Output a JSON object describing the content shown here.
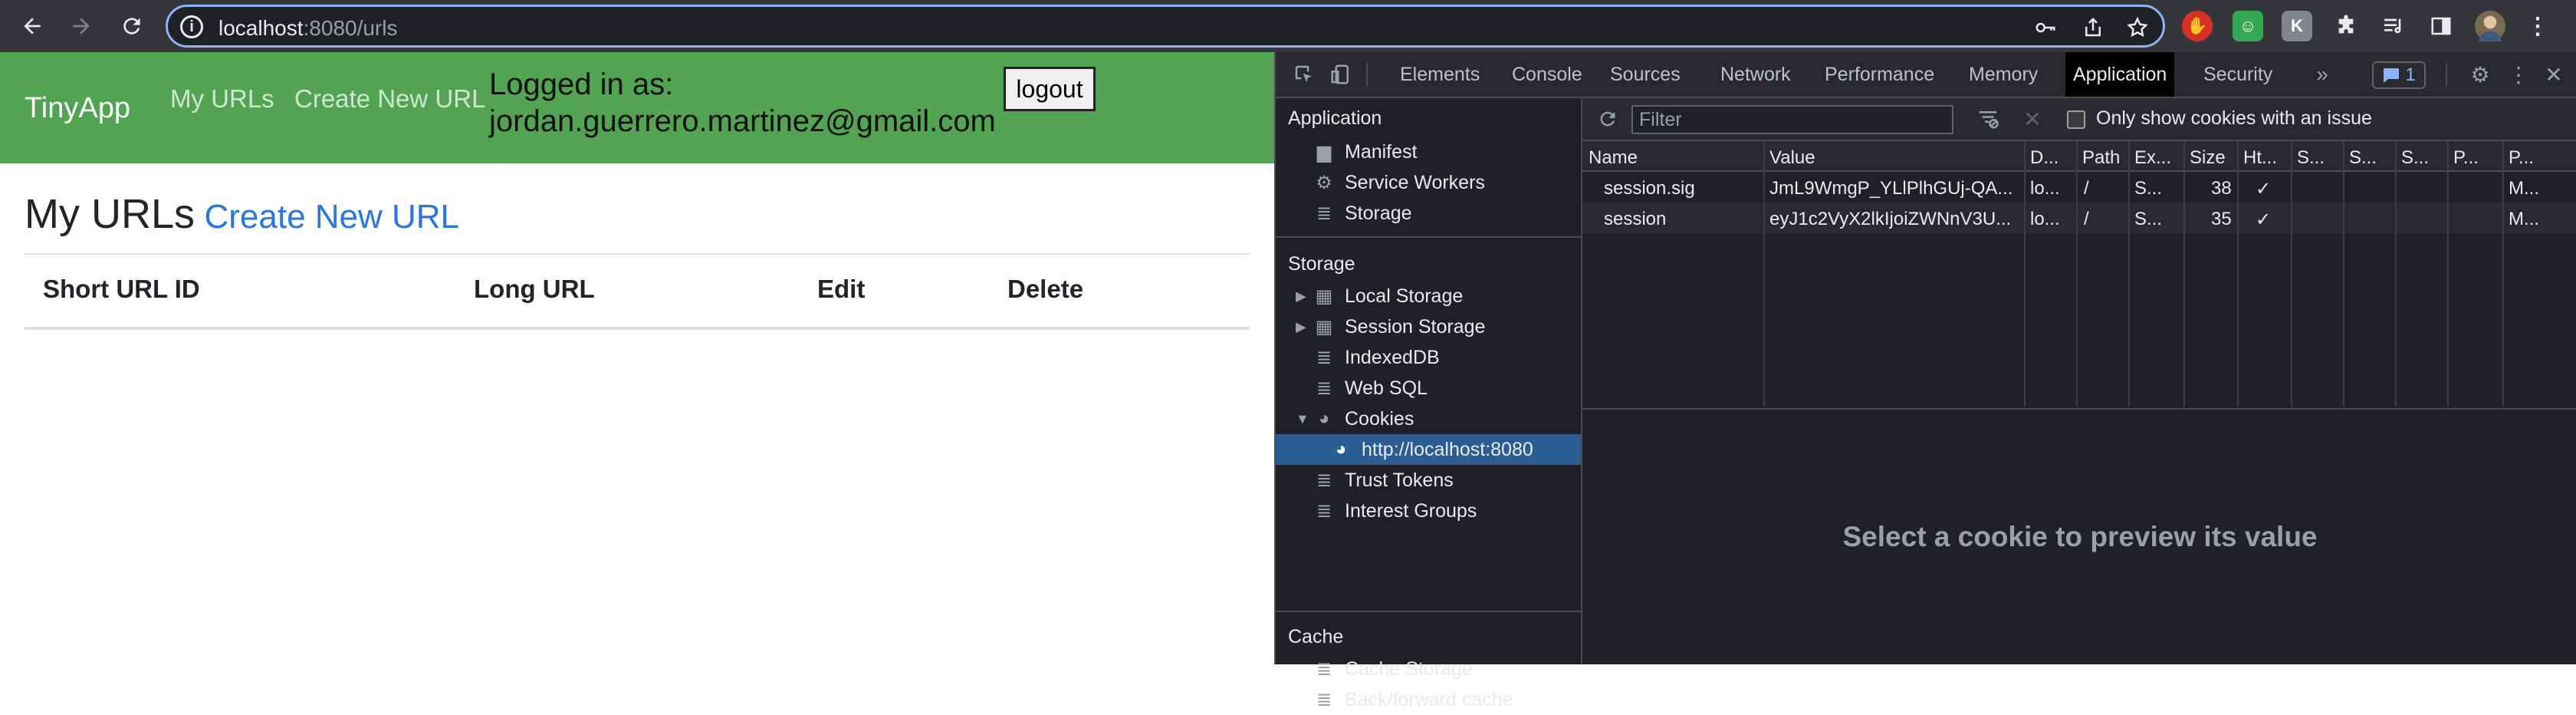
{
  "browser": {
    "url_host": "localhost",
    "url_rest": ":8080/urls"
  },
  "app": {
    "brand": "TinyApp",
    "nav": [
      "My URLs",
      "Create New URL"
    ],
    "logged_label": "Logged in as:",
    "logged_email": "jordan.guerrero.martinez@gmail.com",
    "logout": "logout",
    "heading": "My URLs",
    "heading_link": "Create New URL",
    "table_headers": [
      "Short URL ID",
      "Long URL",
      "Edit",
      "Delete"
    ]
  },
  "devtools": {
    "tabs": [
      "Elements",
      "Console",
      "Sources",
      "Network",
      "Performance",
      "Memory",
      "Application",
      "Security"
    ],
    "active_tab": "Application",
    "issues_count": "1",
    "sidebar": {
      "application_title": "Application",
      "application_items": [
        "Manifest",
        "Service Workers",
        "Storage"
      ],
      "storage_title": "Storage",
      "storage_items": [
        "Local Storage",
        "Session Storage",
        "IndexedDB",
        "Web SQL",
        "Cookies"
      ],
      "cookie_origin": "http://localhost:8080",
      "more_items": [
        "Trust Tokens",
        "Interest Groups"
      ],
      "cache_title": "Cache",
      "cache_items": [
        "Cache Storage",
        "Back/forward cache"
      ]
    },
    "filter_placeholder": "Filter",
    "only_issue_label": "Only show cookies with an issue",
    "columns": [
      "Name",
      "Value",
      "D...",
      "Path",
      "Ex...",
      "Size",
      "Ht...",
      "S...",
      "S...",
      "S...",
      "P...",
      "P..."
    ],
    "rows": [
      [
        "session.sig",
        "JmL9WmgP_YLlPlhGUj-QA...",
        "lo...",
        "/",
        "S...",
        "38",
        "✓",
        "",
        "",
        "",
        "",
        "M..."
      ],
      [
        "session",
        "eyJ1c2VyX2lkIjoiZWNnV3U...",
        "lo...",
        "/",
        "S...",
        "35",
        "✓",
        "",
        "",
        "",
        "",
        "M..."
      ]
    ],
    "preview_message": "Select a cookie to preview its value"
  }
}
